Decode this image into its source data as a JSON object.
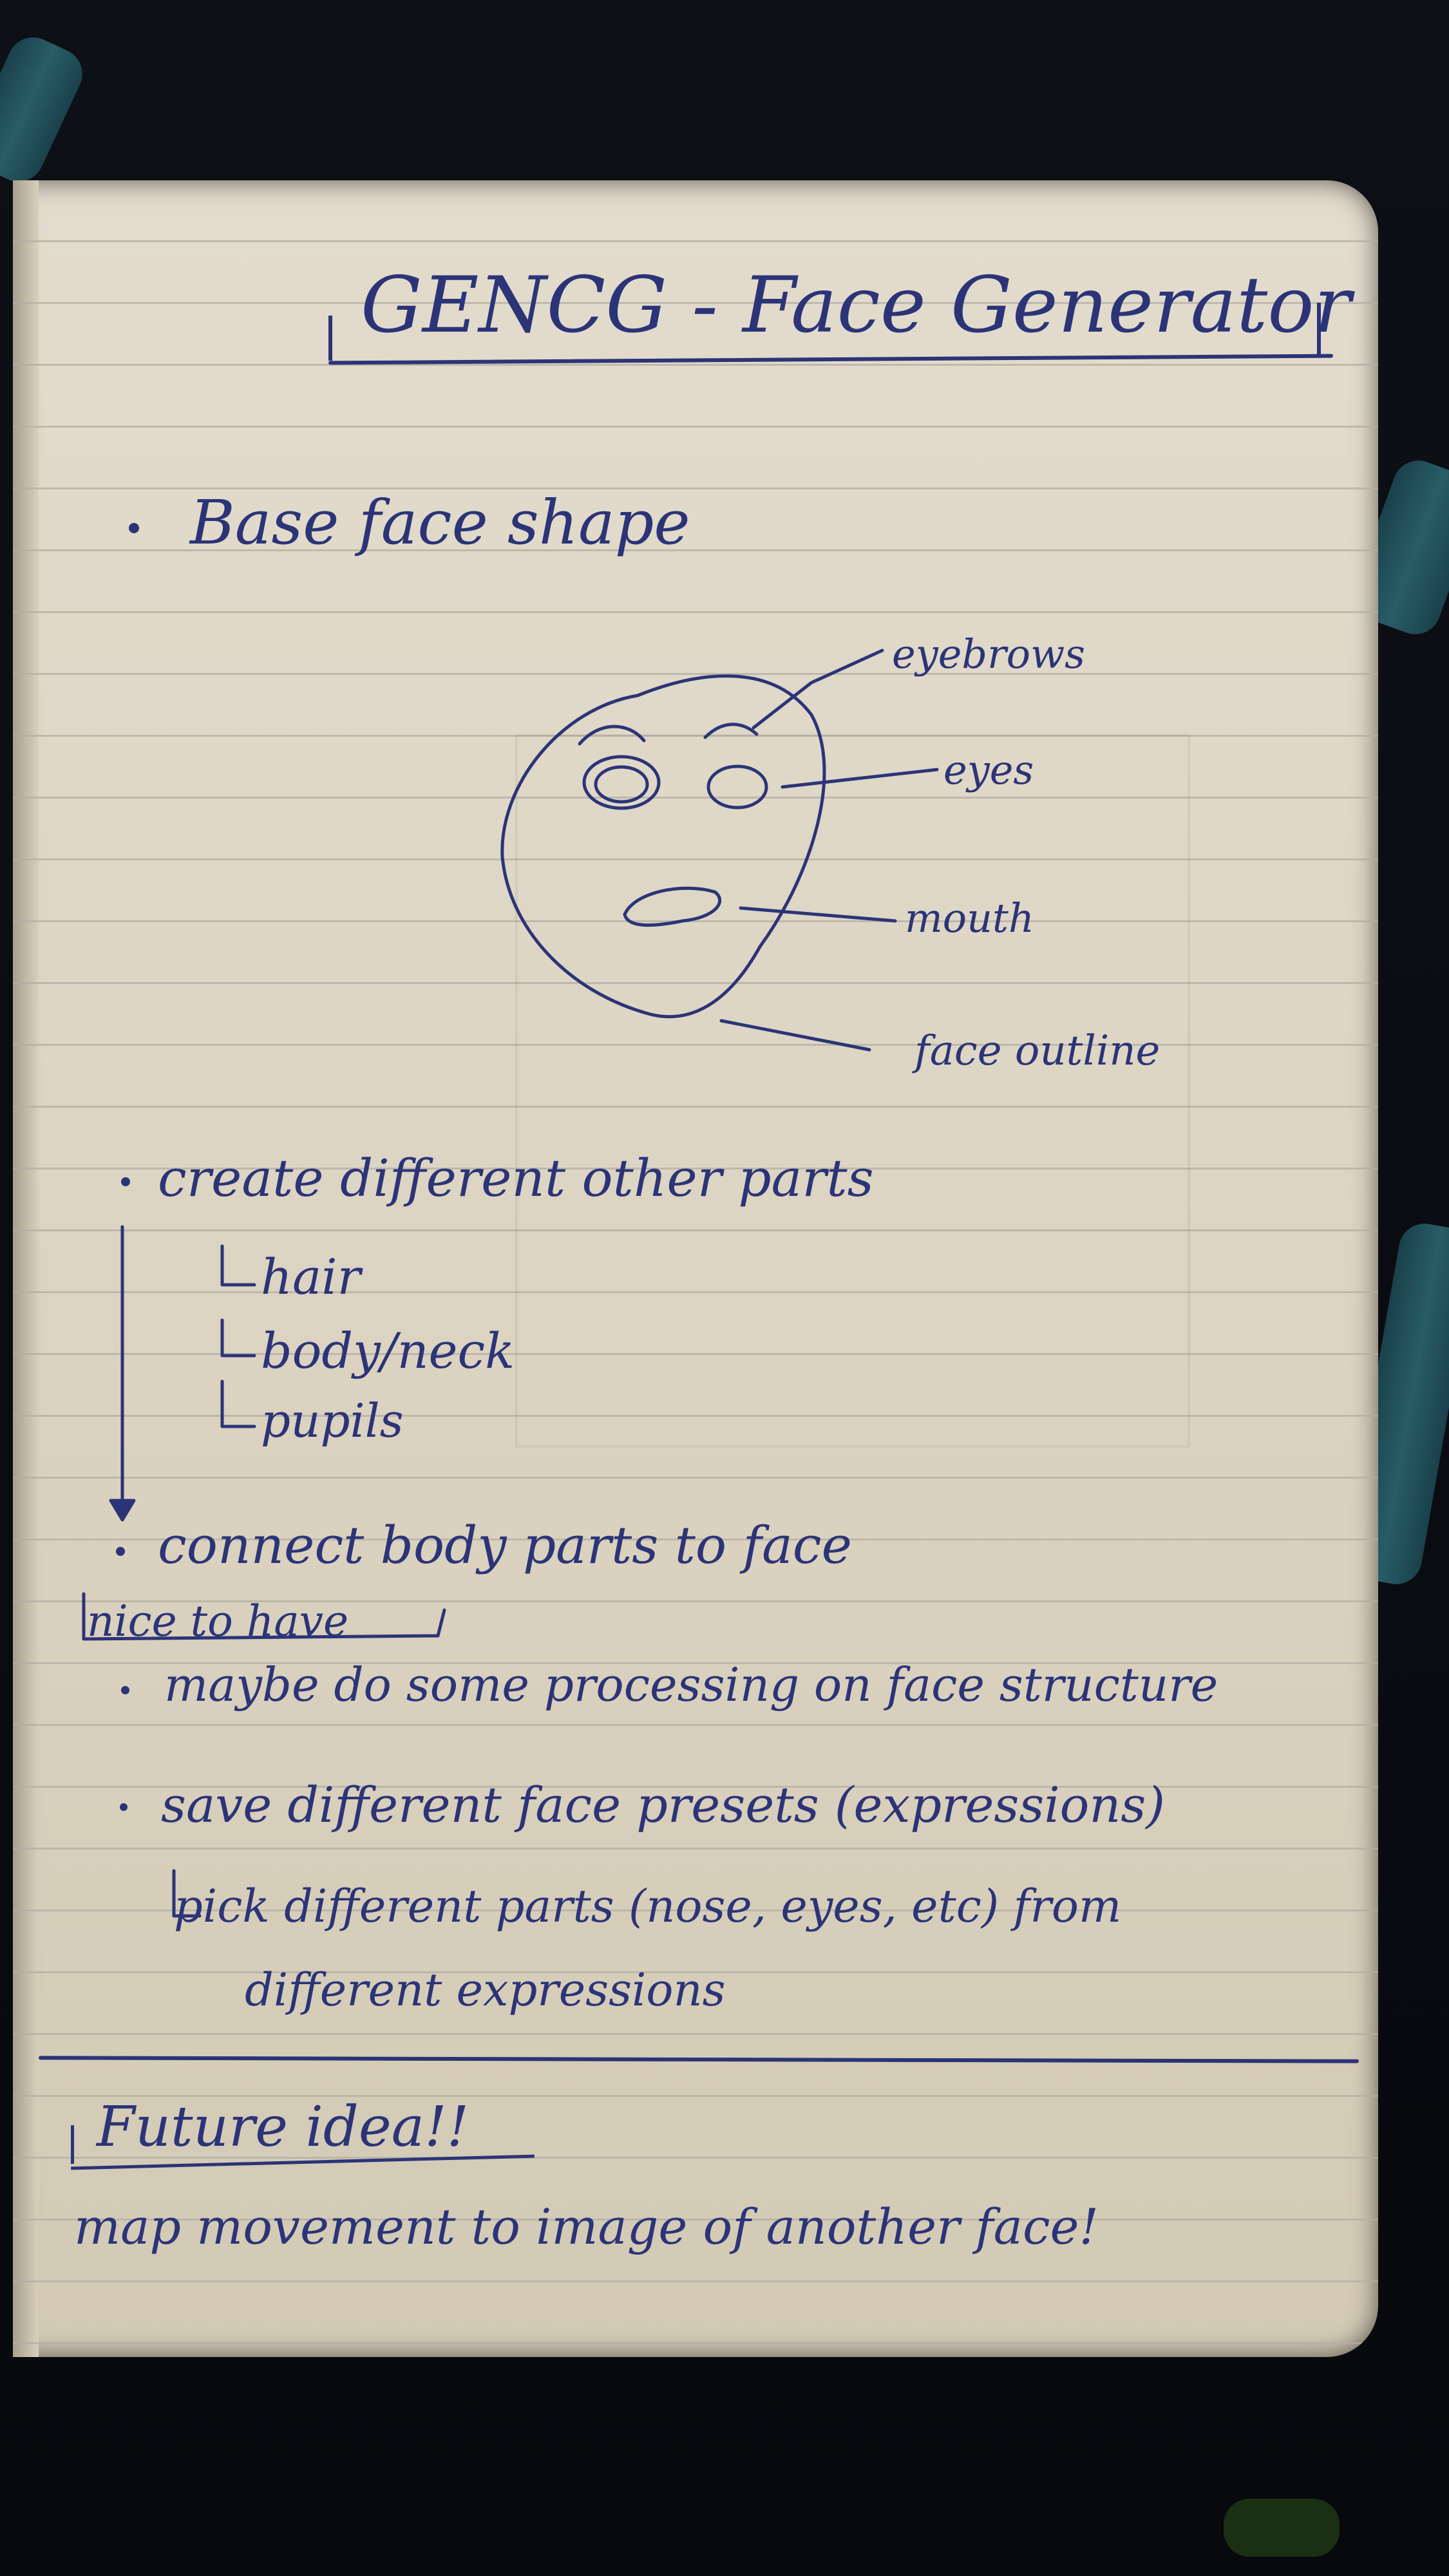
{
  "note": {
    "title": "GENCG - Face Generator",
    "bullet_base_face": "Base face shape",
    "sketch_labels": {
      "eyebrows": "eyebrows",
      "eyes": "eyes",
      "mouth": "mouth",
      "face_outline": "face outline"
    },
    "bullet_create_parts": "create different other parts",
    "sub_parts": [
      "hair",
      "body/neck",
      "pupils"
    ],
    "bullet_connect": "connect body parts to face",
    "nice_to_have": "nice to have",
    "bullet_processing": "maybe do some processing on face structure",
    "bullet_save_presets": "save different face presets (expressions)",
    "pick_parts": "pick different parts (nose, eyes, etc) from",
    "pick_parts_cont": "different expressions",
    "future_heading": "Future idea!!",
    "future_text": "map movement to image of another face!"
  },
  "colors": {
    "ink": "#2c3478",
    "paper": "#e3dccd",
    "ruled_line": "#b4aea3",
    "background": "#0b0d12",
    "strap": "#2d6b74"
  }
}
